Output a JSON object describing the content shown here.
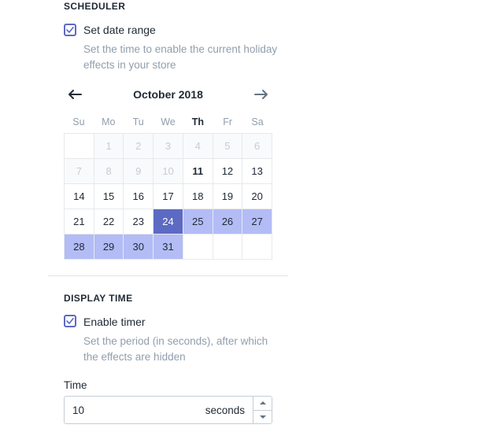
{
  "scheduler": {
    "section_title": "SCHEDULER",
    "checkbox": {
      "label": "Set date range",
      "checked": true,
      "help_text": "Set the time to enable the current holiday effects in your store"
    },
    "calendar": {
      "month_label": "October 2018",
      "prev_icon": "arrow-left-icon",
      "next_icon": "arrow-right-icon",
      "weekdays": [
        "Su",
        "Mo",
        "Tu",
        "We",
        "Th",
        "Fr",
        "Sa"
      ],
      "today_weekday_index": 4,
      "weeks": [
        [
          {
            "label": "",
            "state": "empty"
          },
          {
            "label": "1",
            "state": "disabled"
          },
          {
            "label": "2",
            "state": "disabled"
          },
          {
            "label": "3",
            "state": "disabled"
          },
          {
            "label": "4",
            "state": "disabled"
          },
          {
            "label": "5",
            "state": "disabled"
          },
          {
            "label": "6",
            "state": "disabled"
          }
        ],
        [
          {
            "label": "7",
            "state": "disabled"
          },
          {
            "label": "8",
            "state": "disabled"
          },
          {
            "label": "9",
            "state": "disabled"
          },
          {
            "label": "10",
            "state": "disabled"
          },
          {
            "label": "11",
            "state": "today"
          },
          {
            "label": "12",
            "state": "normal"
          },
          {
            "label": "13",
            "state": "normal"
          }
        ],
        [
          {
            "label": "14",
            "state": "normal"
          },
          {
            "label": "15",
            "state": "normal"
          },
          {
            "label": "16",
            "state": "normal"
          },
          {
            "label": "17",
            "state": "normal"
          },
          {
            "label": "18",
            "state": "normal"
          },
          {
            "label": "19",
            "state": "normal"
          },
          {
            "label": "20",
            "state": "normal"
          }
        ],
        [
          {
            "label": "21",
            "state": "normal"
          },
          {
            "label": "22",
            "state": "normal"
          },
          {
            "label": "23",
            "state": "normal"
          },
          {
            "label": "24",
            "state": "selected"
          },
          {
            "label": "25",
            "state": "in-range"
          },
          {
            "label": "26",
            "state": "in-range"
          },
          {
            "label": "27",
            "state": "in-range"
          }
        ],
        [
          {
            "label": "28",
            "state": "in-range"
          },
          {
            "label": "29",
            "state": "in-range"
          },
          {
            "label": "30",
            "state": "in-range"
          },
          {
            "label": "31",
            "state": "in-range"
          },
          {
            "label": "",
            "state": "empty"
          },
          {
            "label": "",
            "state": "empty"
          },
          {
            "label": "",
            "state": "empty"
          }
        ]
      ]
    }
  },
  "display_time": {
    "section_title": "DISPLAY TIME",
    "checkbox": {
      "label": "Enable timer",
      "checked": true,
      "help_text": "Set the period (in seconds), after which the effects are hidden"
    },
    "time_field": {
      "label": "Time",
      "value": "10",
      "placeholder": "",
      "suffix": "seconds",
      "increment_icon": "caret-up-icon",
      "decrement_icon": "caret-down-icon"
    }
  },
  "colors": {
    "accent": "#5c6ac4",
    "range": "#b3bcf5",
    "text": "#212b36",
    "muted": "#919eab",
    "disabled_text": "#c4cdd5",
    "disabled_bg": "#f9fafb",
    "border": "#e6e9ec",
    "field_border": "#c4cdd5"
  }
}
